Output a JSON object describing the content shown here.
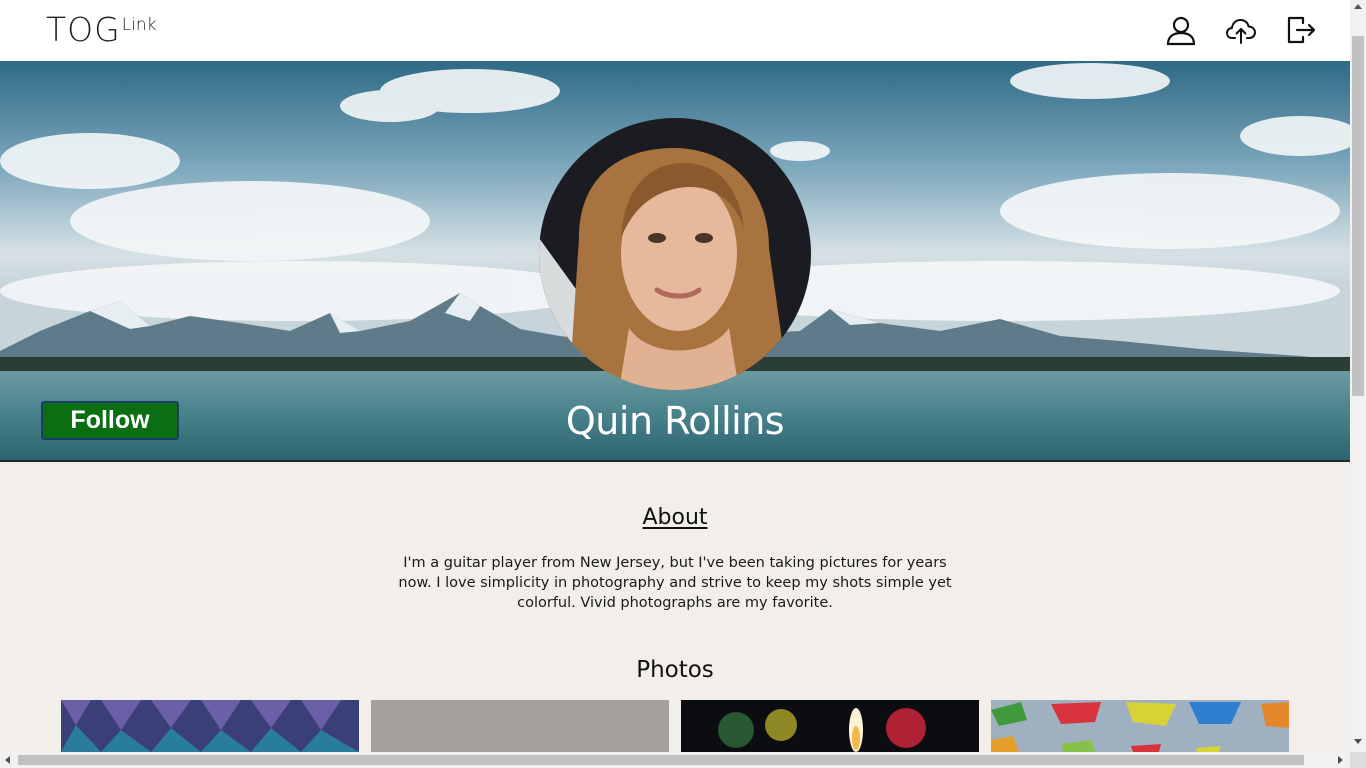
{
  "header": {
    "logo_main": "TOG",
    "logo_sup": "Link",
    "icons": [
      "user-icon",
      "cloud-upload-icon",
      "logout-icon"
    ]
  },
  "profile": {
    "name": "Quin Rollins",
    "follow_label": "Follow"
  },
  "about": {
    "heading": "About",
    "text": "I'm a guitar player from New Jersey, but I've been taking pictures for years now. I love simplicity in photography and strive to keep my shots simple yet colorful. Vivid photographs are my favorite."
  },
  "photos": {
    "heading": "Photos"
  },
  "colors": {
    "follow_button": "#0b6e12",
    "page_background": "#f2efeb",
    "header_background": "#ffffff"
  }
}
